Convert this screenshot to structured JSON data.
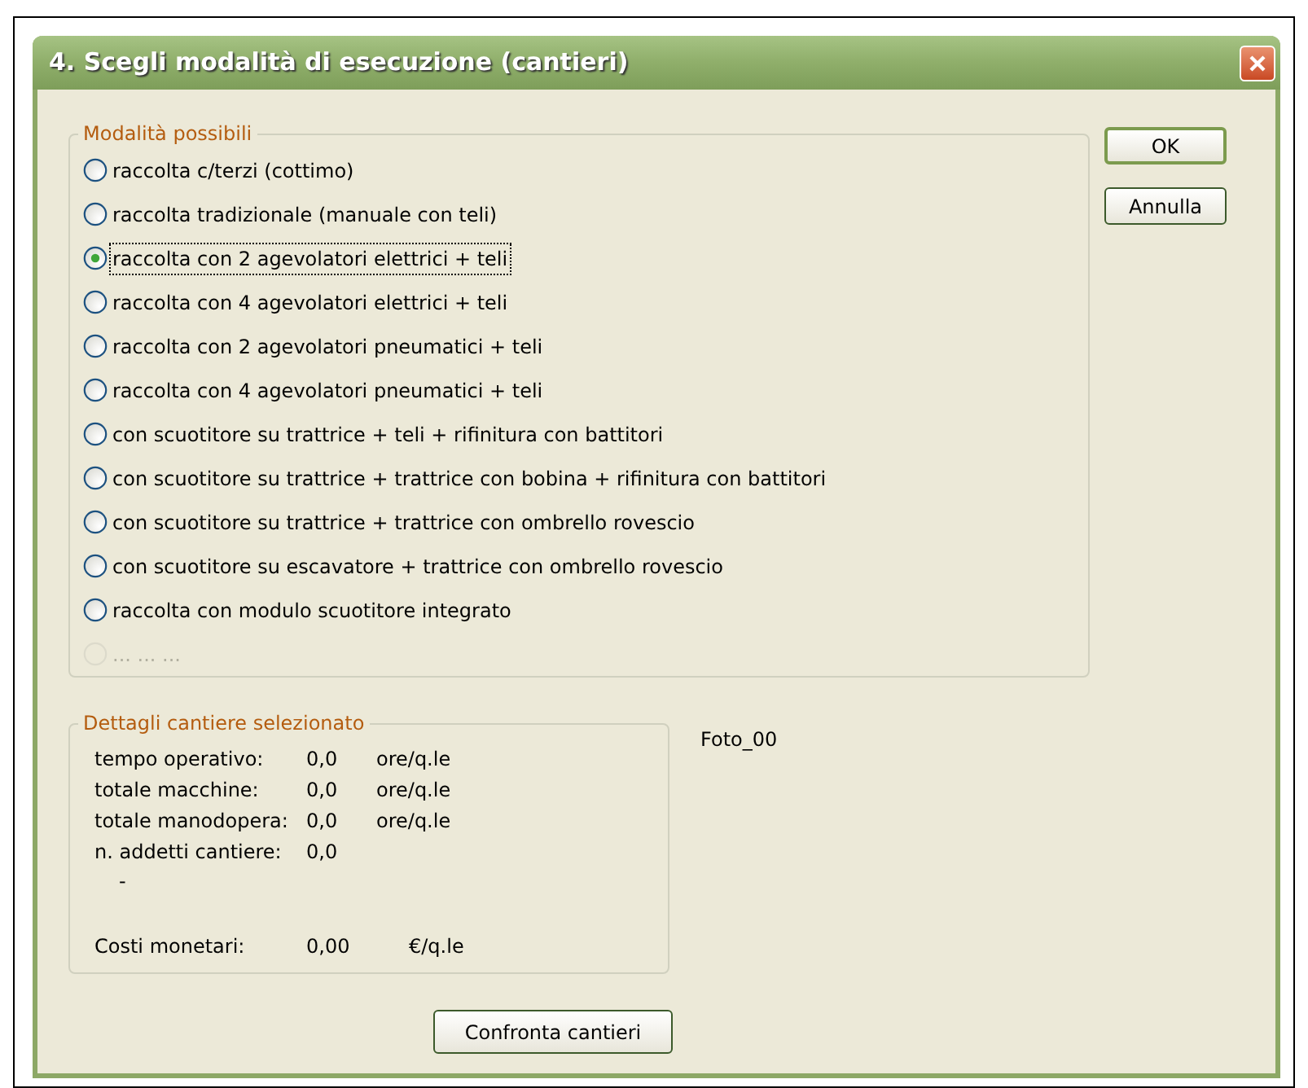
{
  "window": {
    "title": "4. Scegli modalità di esecuzione (cantieri)"
  },
  "modes": {
    "legend": "Modalità possibili",
    "options": [
      {
        "label": "raccolta c/terzi (cottimo)",
        "selected": false,
        "disabled": false
      },
      {
        "label": "raccolta tradizionale (manuale con teli)",
        "selected": false,
        "disabled": false
      },
      {
        "label": "raccolta con 2 agevolatori elettrici + teli",
        "selected": true,
        "disabled": false
      },
      {
        "label": "raccolta con 4 agevolatori elettrici + teli",
        "selected": false,
        "disabled": false
      },
      {
        "label": "raccolta con 2 agevolatori pneumatici + teli",
        "selected": false,
        "disabled": false
      },
      {
        "label": "raccolta con 4 agevolatori pneumatici + teli",
        "selected": false,
        "disabled": false
      },
      {
        "label": "con scuotitore su trattrice + teli + rifinitura con battitori",
        "selected": false,
        "disabled": false
      },
      {
        "label": "con scuotitore su trattrice + trattrice con bobina + rifinitura con battitori",
        "selected": false,
        "disabled": false
      },
      {
        "label": "con scuotitore su trattrice + trattrice con ombrello rovescio",
        "selected": false,
        "disabled": false
      },
      {
        "label": "con scuotitore su escavatore + trattrice con ombrello rovescio",
        "selected": false,
        "disabled": false
      },
      {
        "label": "raccolta con modulo scuotitore integrato",
        "selected": false,
        "disabled": false
      },
      {
        "label": "... ... ...",
        "selected": false,
        "disabled": true
      }
    ]
  },
  "buttons": [
    "OK",
    "Annulla"
  ],
  "details": {
    "legend": "Dettagli cantiere selezionato",
    "rows": [
      {
        "label": "tempo operativo:",
        "value": "0,0",
        "unit": "ore/q.le"
      },
      {
        "label": "totale macchine:",
        "value": "0,0",
        "unit": "ore/q.le"
      },
      {
        "label": "totale manodopera:",
        "value": "0,0",
        "unit": "ore/q.le"
      },
      {
        "label": "n. addetti cantiere:",
        "value": "0,0"
      }
    ],
    "note": "-",
    "cost": {
      "label": "Costi monetari:",
      "value": "0,00",
      "unit": "€/q.le"
    }
  },
  "photo_label": "Foto_00",
  "compare_button": "Confronta cantieri"
}
